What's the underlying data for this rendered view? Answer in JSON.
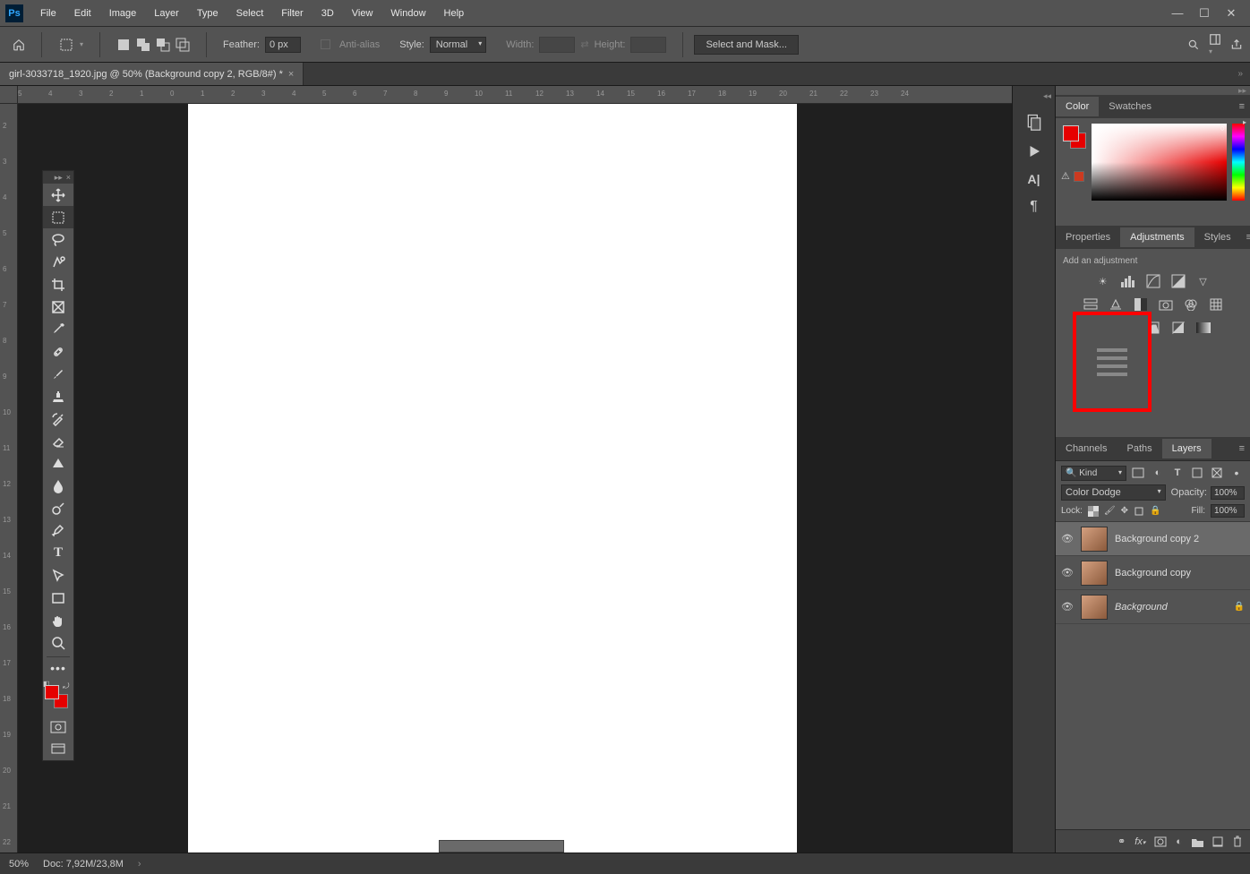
{
  "menubar": {
    "items": [
      "File",
      "Edit",
      "Image",
      "Layer",
      "Type",
      "Select",
      "Filter",
      "3D",
      "View",
      "Window",
      "Help"
    ]
  },
  "optbar": {
    "feather_label": "Feather:",
    "feather_value": "0 px",
    "antialias_label": "Anti-alias",
    "style_label": "Style:",
    "style_value": "Normal",
    "width_label": "Width:",
    "height_label": "Height:",
    "mask_label": "Select and Mask..."
  },
  "document": {
    "tab_title": "girl-3033718_1920.jpg @ 50% (Background copy 2, RGB/8#) *"
  },
  "panels": {
    "color_tab": "Color",
    "swatches_tab": "Swatches",
    "props_tab": "Properties",
    "adjust_tab": "Adjustments",
    "styles_tab": "Styles",
    "add_adj": "Add an adjustment",
    "channels_tab": "Channels",
    "paths_tab": "Paths",
    "layers_tab": "Layers"
  },
  "layers": {
    "filter_label": "Kind",
    "blend_mode": "Color Dodge",
    "opacity_label": "Opacity:",
    "opacity_value": "100%",
    "lock_label": "Lock:",
    "fill_label": "Fill:",
    "fill_value": "100%",
    "items": [
      {
        "name": "Background copy 2",
        "locked": false,
        "selected": true
      },
      {
        "name": "Background copy",
        "locked": false,
        "selected": false
      },
      {
        "name": "Background",
        "locked": true,
        "selected": false,
        "italic": true
      }
    ]
  },
  "status": {
    "zoom": "50%",
    "doc": "Doc: 7,92M/23,8M"
  },
  "colors": {
    "fg": "#e60000",
    "bg": "#e60000"
  },
  "ruler_h": [
    "5",
    "4",
    "3",
    "2",
    "1",
    "0",
    "1",
    "2",
    "3",
    "4",
    "5",
    "6",
    "7",
    "8",
    "9",
    "10",
    "11",
    "12",
    "13",
    "14",
    "15",
    "16",
    "17",
    "18",
    "19",
    "20",
    "21",
    "22",
    "23",
    "24"
  ],
  "ruler_v": [
    "2",
    "3",
    "4",
    "5",
    "6",
    "7",
    "8",
    "9",
    "10",
    "11",
    "12",
    "13",
    "14",
    "15",
    "16",
    "17",
    "18",
    "19",
    "20",
    "21",
    "22"
  ]
}
